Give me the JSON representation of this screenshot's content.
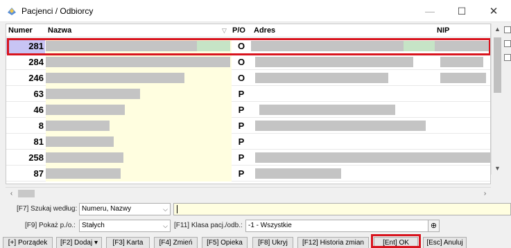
{
  "window": {
    "title": "Pacjenci / Odbiorcy",
    "app_icon": "patient-list-icon",
    "minimize_label": "—",
    "maximize_label": "☐",
    "close_label": "✕"
  },
  "grid": {
    "columns": [
      "Numer",
      "Nazwa",
      "P/O",
      "Adres",
      "NIP"
    ],
    "sort_indicator": "▽",
    "rows": [
      {
        "numer": "281",
        "po": "O"
      },
      {
        "numer": "284",
        "po": "O"
      },
      {
        "numer": "246",
        "po": "O"
      },
      {
        "numer": "63",
        "po": "P"
      },
      {
        "numer": "46",
        "po": "P"
      },
      {
        "numer": "8",
        "po": "P"
      },
      {
        "numer": "81",
        "po": "P"
      },
      {
        "numer": "258",
        "po": "P"
      },
      {
        "numer": "87",
        "po": "P"
      }
    ],
    "selected_row_index": 0
  },
  "filters": {
    "search_by_label": "[F7] Szukaj według:",
    "search_by_value": "Numeru, Nazwy",
    "search_text": "",
    "show_label": "[F9] Pokaż p./o.:",
    "show_value": "Stałych",
    "klasa_label": "[F11] Klasa pacj./odb.:",
    "klasa_value": "-1 - Wszystkie"
  },
  "buttons": {
    "porzadek": "[+] Porządek",
    "dodaj": "[F2] Dodaj ▾",
    "karta": "[F3] Karta",
    "zmien": "[F4] Zmień",
    "opieka": "[F5] Opieka",
    "ukryj": "[F8] Ukryj",
    "historia": "[F12] Historia zmian",
    "ok": "[Ent] OK",
    "anuluj": "[Esc] Anuluj"
  },
  "colors": {
    "selection_outline": "#d8141e",
    "name_column_bg": "#fffee0",
    "selected_number_bg": "#c8c4f4"
  }
}
